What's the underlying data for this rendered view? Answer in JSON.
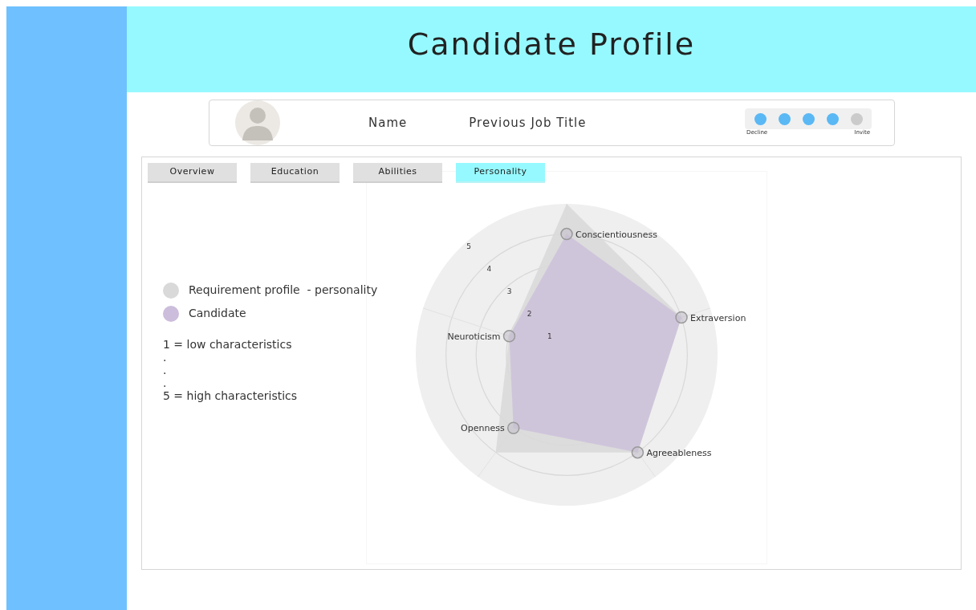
{
  "header": {
    "title": "Candidate Profile"
  },
  "profile": {
    "name": "Name",
    "job_title": "Previous Job Title",
    "progress": {
      "steps": [
        {
          "on": true
        },
        {
          "on": true
        },
        {
          "on": true
        },
        {
          "on": true
        },
        {
          "on": false
        }
      ],
      "start_label": "Decline",
      "end_label": "Invite"
    }
  },
  "tabs": [
    {
      "label": "Overview",
      "selected": false
    },
    {
      "label": "Education",
      "selected": false
    },
    {
      "label": "Abilities",
      "selected": false
    },
    {
      "label": "Personality",
      "selected": true
    }
  ],
  "notes": [
    "1 = low characteristics",
    ".",
    ".",
    ".",
    "5 = high characteristics"
  ],
  "chart_data": {
    "type": "radar",
    "categories": [
      "Conscientiousness",
      "Extraversion",
      "Agreeableness",
      "Openness",
      "Neuroticism"
    ],
    "ylim": [
      0,
      5
    ],
    "yticks": [
      1,
      2,
      3,
      4,
      5
    ],
    "series": [
      {
        "name": "Requirement profile  - personality",
        "color": "#d9d9d9",
        "values": [
          5,
          4,
          4,
          4,
          2
        ]
      },
      {
        "name": "Candidate",
        "color": "#cbbddb",
        "values": [
          4,
          4,
          4,
          3,
          2
        ]
      }
    ]
  }
}
